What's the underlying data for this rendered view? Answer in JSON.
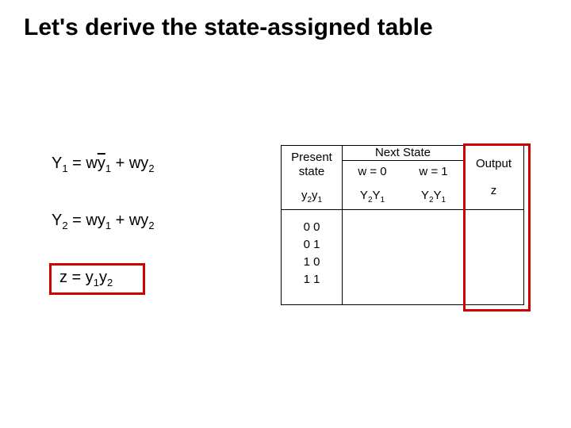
{
  "title": "Let's derive the state-assigned table",
  "equations": {
    "y1_left": "Y",
    "y1_sub1": "1",
    "y1_eq": " = w",
    "y1_y": "y",
    "y1_sub2": "1",
    "y1_plus": " + wy",
    "y1_sub3": "2",
    "y2_left": "Y",
    "y2_sub1": "2",
    "y2_eq": " = ",
    "y2_w": "w",
    "y2_y": "y",
    "y2_sub2": "1",
    "y2_plus": " + wy",
    "y2_sub3": "2",
    "z_left": "z = y",
    "z_sub1": "1",
    "z_mid": "y",
    "z_sub2": "2"
  },
  "table": {
    "present_l1": "Present",
    "present_l2": "state",
    "next_state": "Next State",
    "w0": "w =  0",
    "w1": "w =  1",
    "output": "Output",
    "ps_var": "y",
    "ps_sub1": "2",
    "ps_sub2": "1",
    "ns_var": "Y",
    "ns_sub1": "2",
    "ns_sub2": "1",
    "z": "z",
    "rows": {
      "r0": "0 0",
      "r1": "0 1",
      "r2": "1 0",
      "r3": "1 1"
    }
  },
  "chart_data": {
    "type": "table",
    "title": "State-assigned table (to be derived)",
    "columns": [
      "Present state y2y1",
      "Next state Y2Y1 (w=0)",
      "Next state Y2Y1 (w=1)",
      "Output z"
    ],
    "rows": [
      {
        "present": "00",
        "next_w0": "",
        "next_w1": "",
        "z": ""
      },
      {
        "present": "01",
        "next_w0": "",
        "next_w1": "",
        "z": ""
      },
      {
        "present": "10",
        "next_w0": "",
        "next_w1": "",
        "z": ""
      },
      {
        "present": "11",
        "next_w0": "",
        "next_w1": "",
        "z": ""
      }
    ],
    "equations": [
      "Y1 = w·ȳ1 + w·y2",
      "Y2 = w·y1 + w·y2",
      "z  = y1·y2"
    ]
  }
}
